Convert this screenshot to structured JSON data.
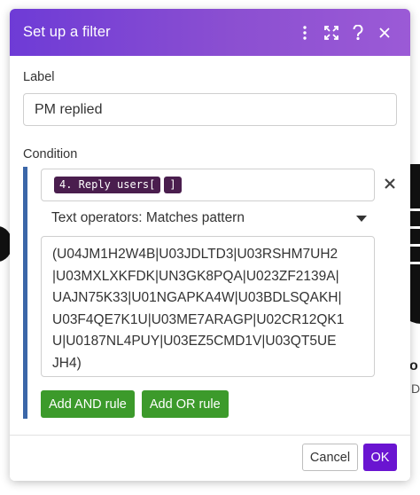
{
  "dialog": {
    "title": "Set up a filter",
    "header_icons": [
      "more-vertical-icon",
      "expand-icon",
      "help-icon",
      "close-icon"
    ],
    "header_gradient": [
      "#6e3bd6",
      "#9b5ad6"
    ]
  },
  "label_field": {
    "label": "Label",
    "value": "PM replied"
  },
  "condition": {
    "label": "Condition",
    "operand_tokens": [
      "4. Reply users[",
      "]"
    ],
    "operator": "Text operators: Matches pattern",
    "pattern_lines": [
      "(U04JM1H2W4B|U03JDLTD3|U03RSHM7UH2",
      "|U03MXLXKFDK|UN3GK8PQA|U023ZF2139A|",
      "UAJN75K33|U01NGAPKA4W|U03BDLSQAKH|",
      "U03F4QE7K1U|U03ME7ARAGP|U02CR12QK1",
      "U|U0187NL4PUY|U03EZ5CMD1V|U03QT5UE",
      "JH4)"
    ],
    "add_and_label": "Add AND rule",
    "add_or_label": "Add OR rule",
    "accent_color": "#3b67a8",
    "button_color": "#3c9a2b"
  },
  "footer": {
    "cancel_label": "Cancel",
    "ok_label": "OK",
    "ok_color": "#6a14d1"
  },
  "background": {
    "partial_text_1": "o",
    "partial_text_2": "D"
  }
}
